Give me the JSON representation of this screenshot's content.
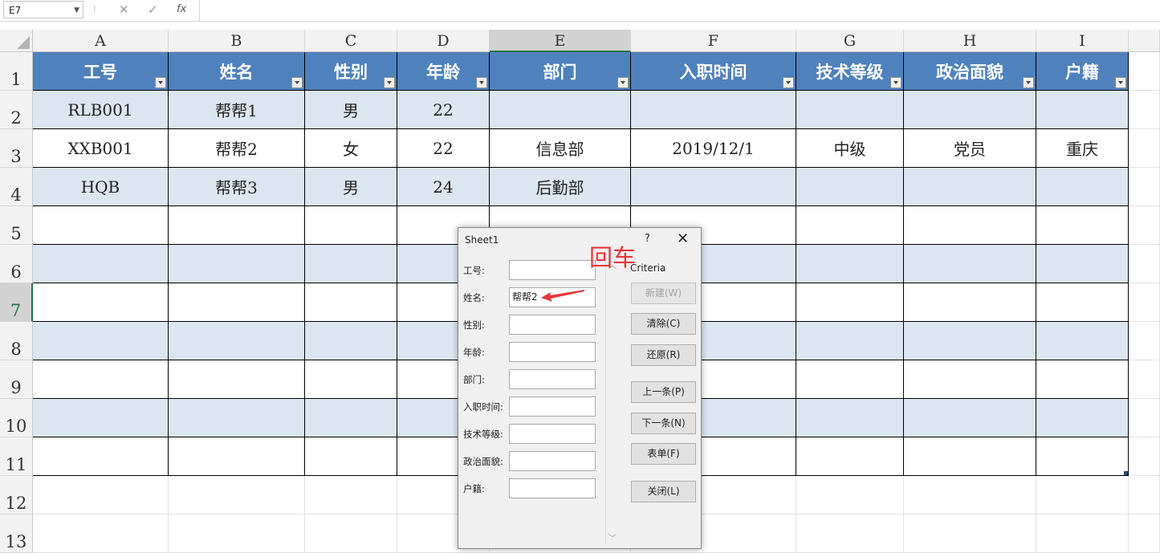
{
  "formula_bar": {
    "name_box": "E7",
    "cancel_icon": "✕",
    "enter_icon": "✓",
    "fx_icon": "fx",
    "formula": ""
  },
  "columns": [
    "A",
    "B",
    "C",
    "D",
    "E",
    "F",
    "G",
    "H",
    "I"
  ],
  "rows": [
    "1",
    "2",
    "3",
    "4",
    "5",
    "6",
    "7",
    "8",
    "9",
    "10",
    "11",
    "12",
    "13"
  ],
  "selected": {
    "column": "E",
    "row": "7"
  },
  "table": {
    "headers": [
      "工号",
      "姓名",
      "性别",
      "年龄",
      "部门",
      "入职时间",
      "技术等级",
      "政治面貌",
      "户籍"
    ],
    "rows": [
      [
        "RLB001",
        "帮帮1",
        "男",
        "22",
        "",
        "",
        "",
        "",
        ""
      ],
      [
        "XXB001",
        "帮帮2",
        "女",
        "22",
        "信息部",
        "2019/12/1",
        "中级",
        "党员",
        "重庆"
      ],
      [
        "HQB",
        "帮帮3",
        "男",
        "24",
        "后勤部",
        "",
        "",
        "",
        ""
      ]
    ],
    "header_color": "#4f81bd",
    "band_color": "#dce6f1"
  },
  "dialog": {
    "title": "Sheet1",
    "help": "?",
    "close": "✕",
    "criteria_label": "Criteria",
    "fields": [
      {
        "label": "工号:",
        "value": ""
      },
      {
        "label": "姓名:",
        "value": "帮帮2"
      },
      {
        "label": "性别:",
        "value": ""
      },
      {
        "label": "年龄:",
        "value": ""
      },
      {
        "label": "部门:",
        "value": ""
      },
      {
        "label": "入职时间:",
        "value": ""
      },
      {
        "label": "技术等级:",
        "value": ""
      },
      {
        "label": "政治面貌:",
        "value": ""
      },
      {
        "label": "户籍:",
        "value": ""
      }
    ],
    "buttons": {
      "new": "新建(W)",
      "clear": "清除(C)",
      "restore": "还原(R)",
      "prev": "上一条(P)",
      "next": "下一条(N)",
      "form": "表单(F)",
      "close": "关闭(L)"
    }
  },
  "annotation": {
    "text": "回车",
    "color": "#e8353b"
  }
}
